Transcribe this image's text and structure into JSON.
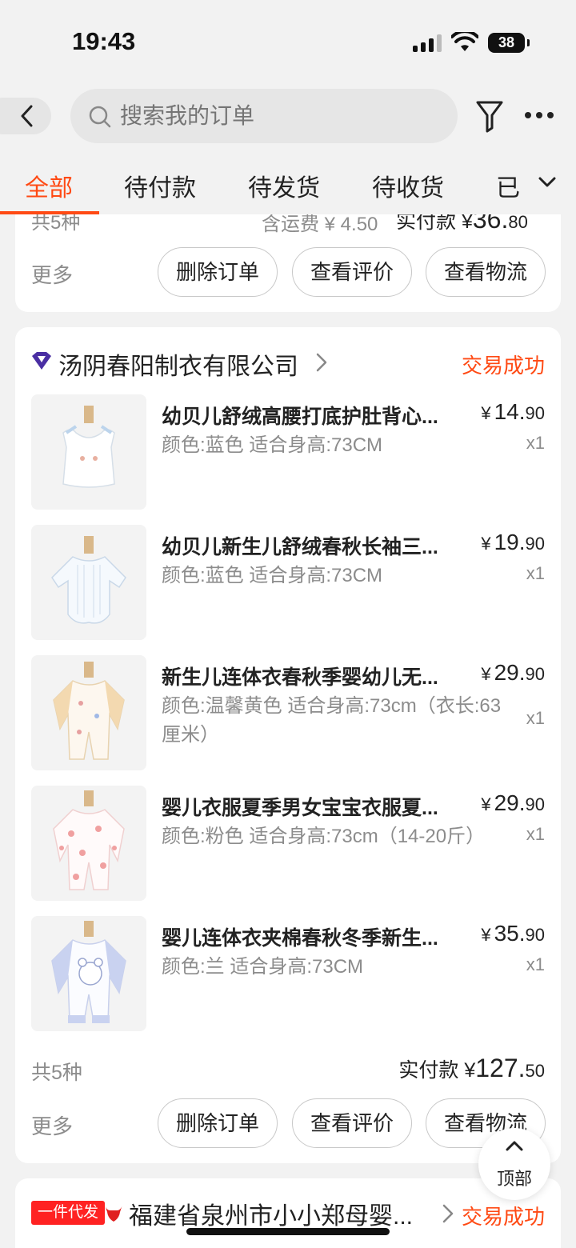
{
  "status_bar": {
    "time": "19:43",
    "battery": "38"
  },
  "search": {
    "placeholder": "搜索我的订单"
  },
  "tabs": [
    {
      "label": "全部",
      "active": true
    },
    {
      "label": "待付款"
    },
    {
      "label": "待发货"
    },
    {
      "label": "待收货"
    },
    {
      "label": "已"
    }
  ],
  "order_prev": {
    "count": "共5种",
    "shipping": "含运费 ¥ 4.50",
    "paid_label": "实付款 ¥",
    "paid_int": "36.",
    "paid_dec": "80",
    "more": "更多",
    "buttons": [
      "删除订单",
      "查看评价",
      "查看物流"
    ]
  },
  "order_main": {
    "shop": "汤阴春阳制衣有限公司",
    "status": "交易成功",
    "items": [
      {
        "title": "幼贝儿舒绒高腰打底护肚背心...",
        "spec": "颜色:蓝色 适合身高:73CM",
        "price_int": "14.",
        "price_dec": "90",
        "qty": "x1"
      },
      {
        "title": "幼贝儿新生儿舒绒春秋长袖三...",
        "spec": "颜色:蓝色 适合身高:73CM",
        "price_int": "19.",
        "price_dec": "90",
        "qty": "x1"
      },
      {
        "title": "新生儿连体衣春秋季婴幼儿无...",
        "spec": "颜色:温馨黄色 适合身高:73cm（衣长:63厘米）",
        "price_int": "29.",
        "price_dec": "90",
        "qty": "x1"
      },
      {
        "title": "婴儿衣服夏季男女宝宝衣服夏...",
        "spec": "颜色:粉色 适合身高:73cm（14-20斤）",
        "price_int": "29.",
        "price_dec": "90",
        "qty": "x1"
      },
      {
        "title": "婴儿连体衣夹棉春秋冬季新生...",
        "spec": "颜色:兰 适合身高:73CM",
        "price_int": "35.",
        "price_dec": "90",
        "qty": "x1"
      }
    ],
    "count": "共5种",
    "paid_label": "实付款 ¥",
    "paid_int": "127.",
    "paid_dec": "50",
    "more": "更多",
    "buttons": [
      "删除订单",
      "查看评价",
      "查看物流"
    ]
  },
  "order_next": {
    "tag": "一件代发",
    "shop": "福建省泉州市小小郑母婴...",
    "status": "交易成功"
  },
  "fab": {
    "label": "顶部"
  },
  "colors": {
    "accent": "#ff4a14",
    "tag": "#ff2222",
    "background": "#f2f2f2"
  }
}
